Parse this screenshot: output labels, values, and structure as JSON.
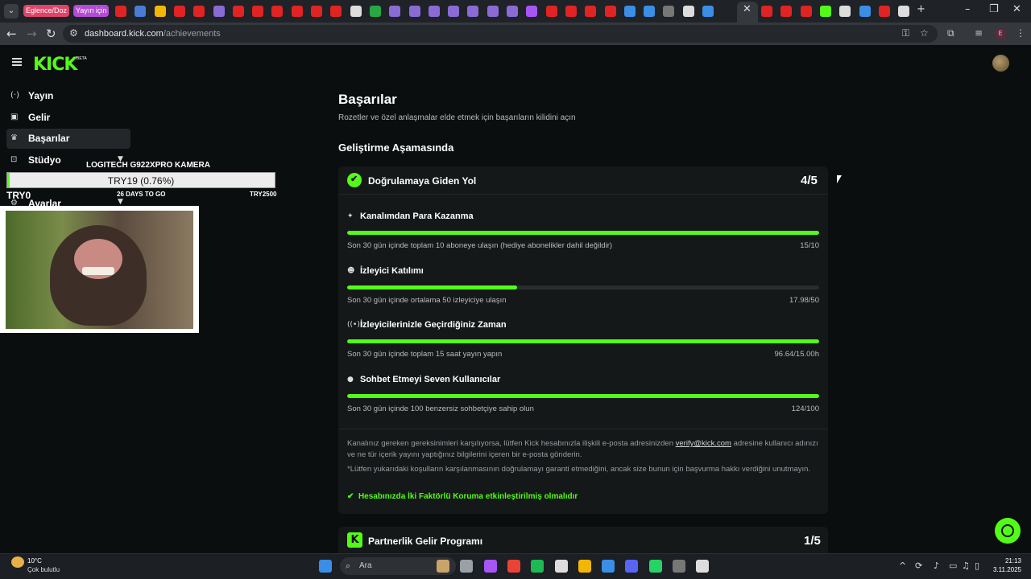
{
  "browser": {
    "tab_groups": [
      {
        "label": "Eglence/Doz",
        "color": "#e0446a"
      },
      {
        "label": "Yayın için",
        "color": "#b34bd6"
      }
    ],
    "url_host": "dashboard.kick.com",
    "url_path": "/achievements"
  },
  "app": {
    "logo": "KICK",
    "logo_tag": "BETA",
    "sidebar": [
      {
        "icon": "broadcast-icon",
        "glyph": "(·)",
        "label": "Yayın"
      },
      {
        "icon": "revenue-icon",
        "glyph": "▣",
        "label": "Gelir"
      },
      {
        "icon": "trophy-icon",
        "glyph": "♛",
        "label": "Başarılar"
      },
      {
        "icon": "studio-icon",
        "glyph": "⊡",
        "label": "Stüdyo"
      },
      {
        "icon": "gear-icon",
        "glyph": "⚙",
        "label": "Ayarlar"
      }
    ]
  },
  "overlay": {
    "title": "LOGITECH G922XPRO KAMERA",
    "progress_text": "TRY19 (0.76%)",
    "progress": 0.0076,
    "start": "TRY0",
    "days": "26 DAYS TO GO",
    "goal": "TRY2500"
  },
  "page": {
    "title": "Başarılar",
    "subtitle": "Rozetler ve özel anlaşmalar elde etmek için başarıların kilidini açın",
    "section": "Geliştirme Aşamasında"
  },
  "verify_card": {
    "title": "Doğrulamaya Giden Yol",
    "score": "4/5",
    "requirements": [
      {
        "icon": "sparkle-icon",
        "glyph": "✦",
        "title": "Kanalımdan Para Kazanma",
        "desc": "Son 30 gün içinde toplam 10 aboneye ulaşın (hediye abonelikler dahil değildir)",
        "value": "15/10",
        "progress": 1.0
      },
      {
        "icon": "viewers-icon",
        "glyph": "☻",
        "title": "İzleyici Katılımı",
        "desc": "Son 30 gün içinde ortalama 50 izleyiciye ulaşın",
        "value": "17.98/50",
        "progress": 0.3596
      },
      {
        "icon": "signal-icon",
        "glyph": "((•))",
        "title": "İzleyicilerinizle Geçirdiğiniz Zaman",
        "desc": "Son 30 gün içinde toplam 15 saat yayın yapın",
        "value": "96.64/15.00h",
        "progress": 1.0
      },
      {
        "icon": "chat-icon",
        "glyph": "●",
        "title": "Sohbet Etmeyi Seven Kullanıcılar",
        "desc": "Son 30 gün içinde 100 benzersiz sohbetçiye sahip olun",
        "value": "124/100",
        "progress": 1.0
      }
    ],
    "note_prefix": "Kanalınız gereken gereksinimleri karşılıyorsa, lütfen Kick hesabınızla ilişkili e-posta adresinizden ",
    "note_link": "verify@kick.com",
    "note_suffix": " adresine kullanıcı adınızı ve ne tür içerik yayını yaptığınız bilgilerini içeren bir e-posta gönderin.",
    "note2": "*Lütfen yukarıdaki koşulların karşılanmasının doğrulamayı garanti etmediğini, ancak size bunun için başvurma hakkı verdiğini unutmayın.",
    "check_mark": "✔",
    "check_text": "Hesabınızda İki Faktörlü Koruma etkinleştirilmiş olmalıdır"
  },
  "partner_card": {
    "icon_letter": "K",
    "title": "Partnerlik Gelir Programı",
    "score": "1/5"
  },
  "taskbar": {
    "temp": "10°C",
    "weather": "Çok bulutlu",
    "search": "Ara",
    "time": "21:13",
    "date": "3.11.2025"
  },
  "colors": {
    "accent": "#53fc18",
    "bg": "#0b0e0f",
    "card": "#151819"
  }
}
